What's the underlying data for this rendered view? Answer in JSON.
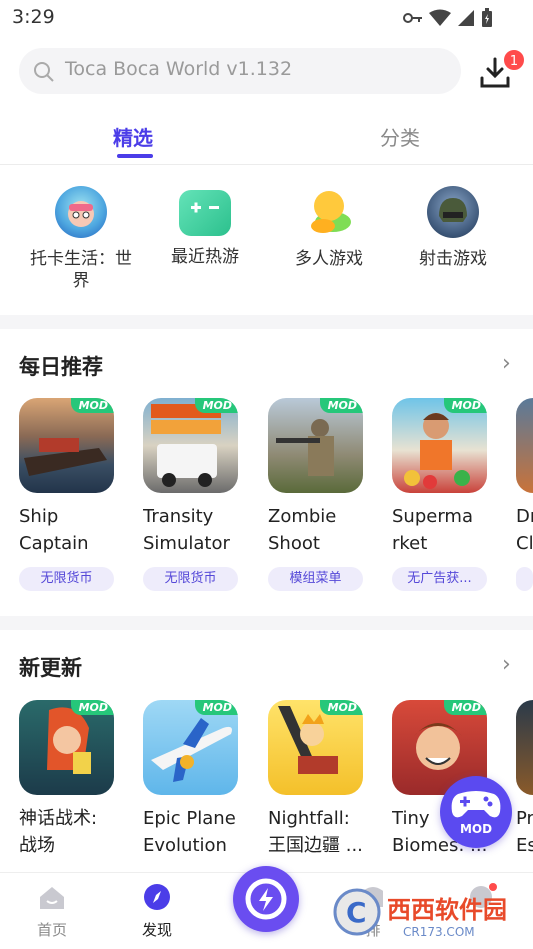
{
  "status": {
    "time": "3:29"
  },
  "search": {
    "placeholder": "Toca Boca World v1.132"
  },
  "download": {
    "badge": "1"
  },
  "tabs": [
    {
      "label": "精选"
    },
    {
      "label": "分类"
    }
  ],
  "categories": [
    {
      "label": "托卡生活：世界"
    },
    {
      "label": "最近热游"
    },
    {
      "label": "多人游戏"
    },
    {
      "label": "射击游戏"
    }
  ],
  "daily": {
    "title": "每日推荐",
    "badge": "MOD",
    "items": [
      {
        "name": "Ship Captain S...",
        "tag": "无限货币"
      },
      {
        "name": "Transity Simulator",
        "tag": "无限货币"
      },
      {
        "name": "Zombie Shoot Ou...",
        "tag": "模组菜单"
      },
      {
        "name": "Superma rket Food...",
        "tag": "无广告获..."
      },
      {
        "name": "Dr Cl",
        "tag": ""
      }
    ]
  },
  "updates": {
    "title": "新更新",
    "badge": "MOD",
    "items": [
      {
        "name": "神话战术: 战场"
      },
      {
        "name": "Epic Plane Evolution"
      },
      {
        "name": "Nightfall: 王国边疆 ..."
      },
      {
        "name": "Tiny Biomes: ..."
      },
      {
        "name": "Pr Es"
      }
    ]
  },
  "mod_fab": {
    "label": "MOD"
  },
  "bottom_nav": [
    {
      "label": "首页"
    },
    {
      "label": "发现"
    },
    {
      "label": ""
    },
    {
      "label": "排"
    },
    {
      "label": ""
    }
  ],
  "watermark": {
    "brand": "西西软件园",
    "url": "CR173.COM"
  },
  "colors": {
    "accent": "#4b3de8",
    "mod_green": "#26c77a",
    "badge_red": "#ff4b4b"
  }
}
